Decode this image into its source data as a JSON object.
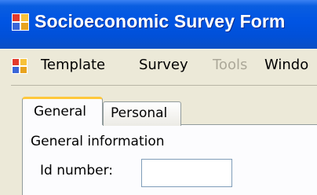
{
  "window": {
    "title": "Socioeconomic Survey Form",
    "icon": "app-form-icon"
  },
  "menubar": {
    "icon": "mdi-child-icon",
    "items": [
      {
        "label": "Template",
        "enabled": true
      },
      {
        "label": "Survey",
        "enabled": true
      },
      {
        "label": "Tools",
        "enabled": false
      },
      {
        "label": "Windo",
        "enabled": true
      }
    ]
  },
  "tabs": [
    {
      "label": "General",
      "selected": true
    },
    {
      "label": "Personal",
      "selected": false
    }
  ],
  "general": {
    "section_label": "General information",
    "id_label": "Id number:",
    "id_value": ""
  },
  "colors": {
    "titlebar": "#0054E3",
    "tab_highlight": "#FFC83C",
    "disabled_text": "#ACA899"
  }
}
